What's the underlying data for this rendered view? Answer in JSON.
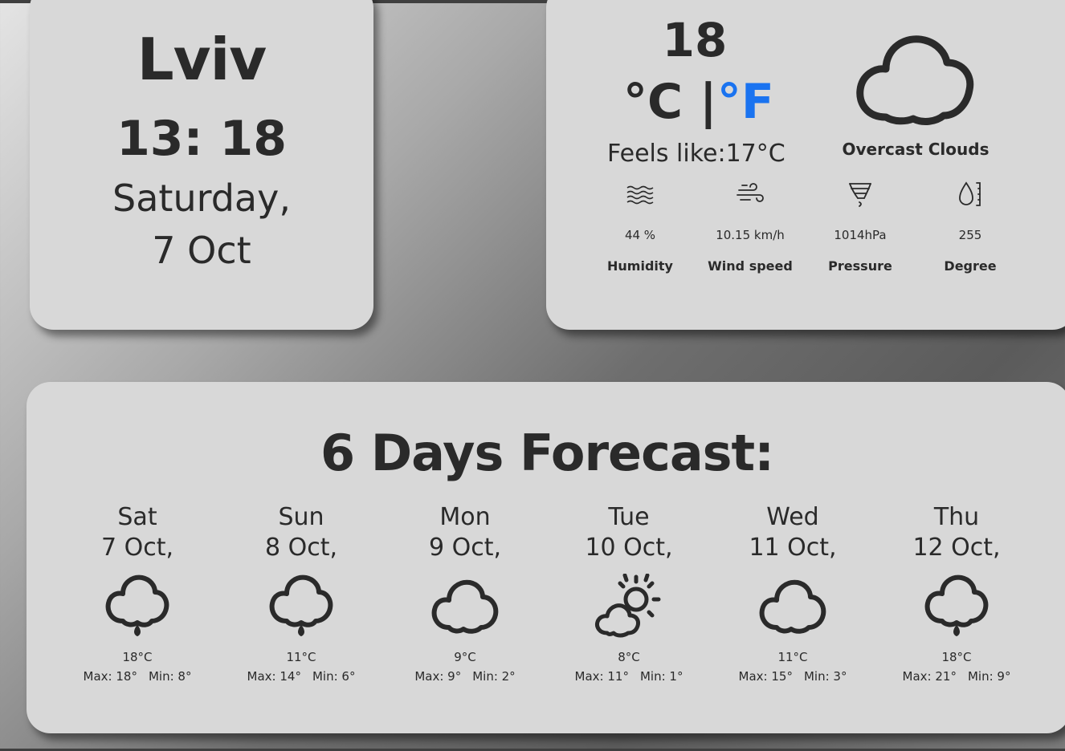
{
  "city": {
    "name": "Lviv",
    "time": "13: 18",
    "day": "Saturday,",
    "date": "7 Oct"
  },
  "current": {
    "temp": "18",
    "unit_c": "°C",
    "unit_sep": " |",
    "unit_f": "°F",
    "feels_like": "Feels like:17°C",
    "condition": "Overcast Clouds",
    "condition_icon": "cloud-icon",
    "accent_color": "#1a73f0",
    "metrics": [
      {
        "icon": "waves-icon",
        "value": "44 %",
        "label": "Humidity"
      },
      {
        "icon": "wind-icon",
        "value": "10.15 km/h",
        "label": "Wind speed"
      },
      {
        "icon": "tornado-icon",
        "value": "1014hPa",
        "label": "Pressure"
      },
      {
        "icon": "droplet-gauge-icon",
        "value": "255",
        "label": "Degree"
      }
    ]
  },
  "forecast": {
    "title": "6 Days Forecast:",
    "days": [
      {
        "day": "Sat",
        "date": "7 Oct,",
        "icon": "rain-cloud-icon",
        "temp": "18°C",
        "max": "Max: 18°",
        "min": "Min: 8°"
      },
      {
        "day": "Sun",
        "date": "8 Oct,",
        "icon": "rain-cloud-icon",
        "temp": "11°C",
        "max": "Max: 14°",
        "min": "Min: 6°"
      },
      {
        "day": "Mon",
        "date": "9 Oct,",
        "icon": "cloud-icon",
        "temp": "9°C",
        "max": "Max: 9°",
        "min": "Min: 2°"
      },
      {
        "day": "Tue",
        "date": "10 Oct,",
        "icon": "sun-cloud-icon",
        "temp": "8°C",
        "max": "Max: 11°",
        "min": "Min: 1°"
      },
      {
        "day": "Wed",
        "date": "11 Oct,",
        "icon": "cloud-icon",
        "temp": "11°C",
        "max": "Max: 15°",
        "min": "Min: 3°"
      },
      {
        "day": "Thu",
        "date": "12 Oct,",
        "icon": "rain-cloud-icon",
        "temp": "18°C",
        "max": "Max: 21°",
        "min": "Min: 9°"
      }
    ]
  }
}
